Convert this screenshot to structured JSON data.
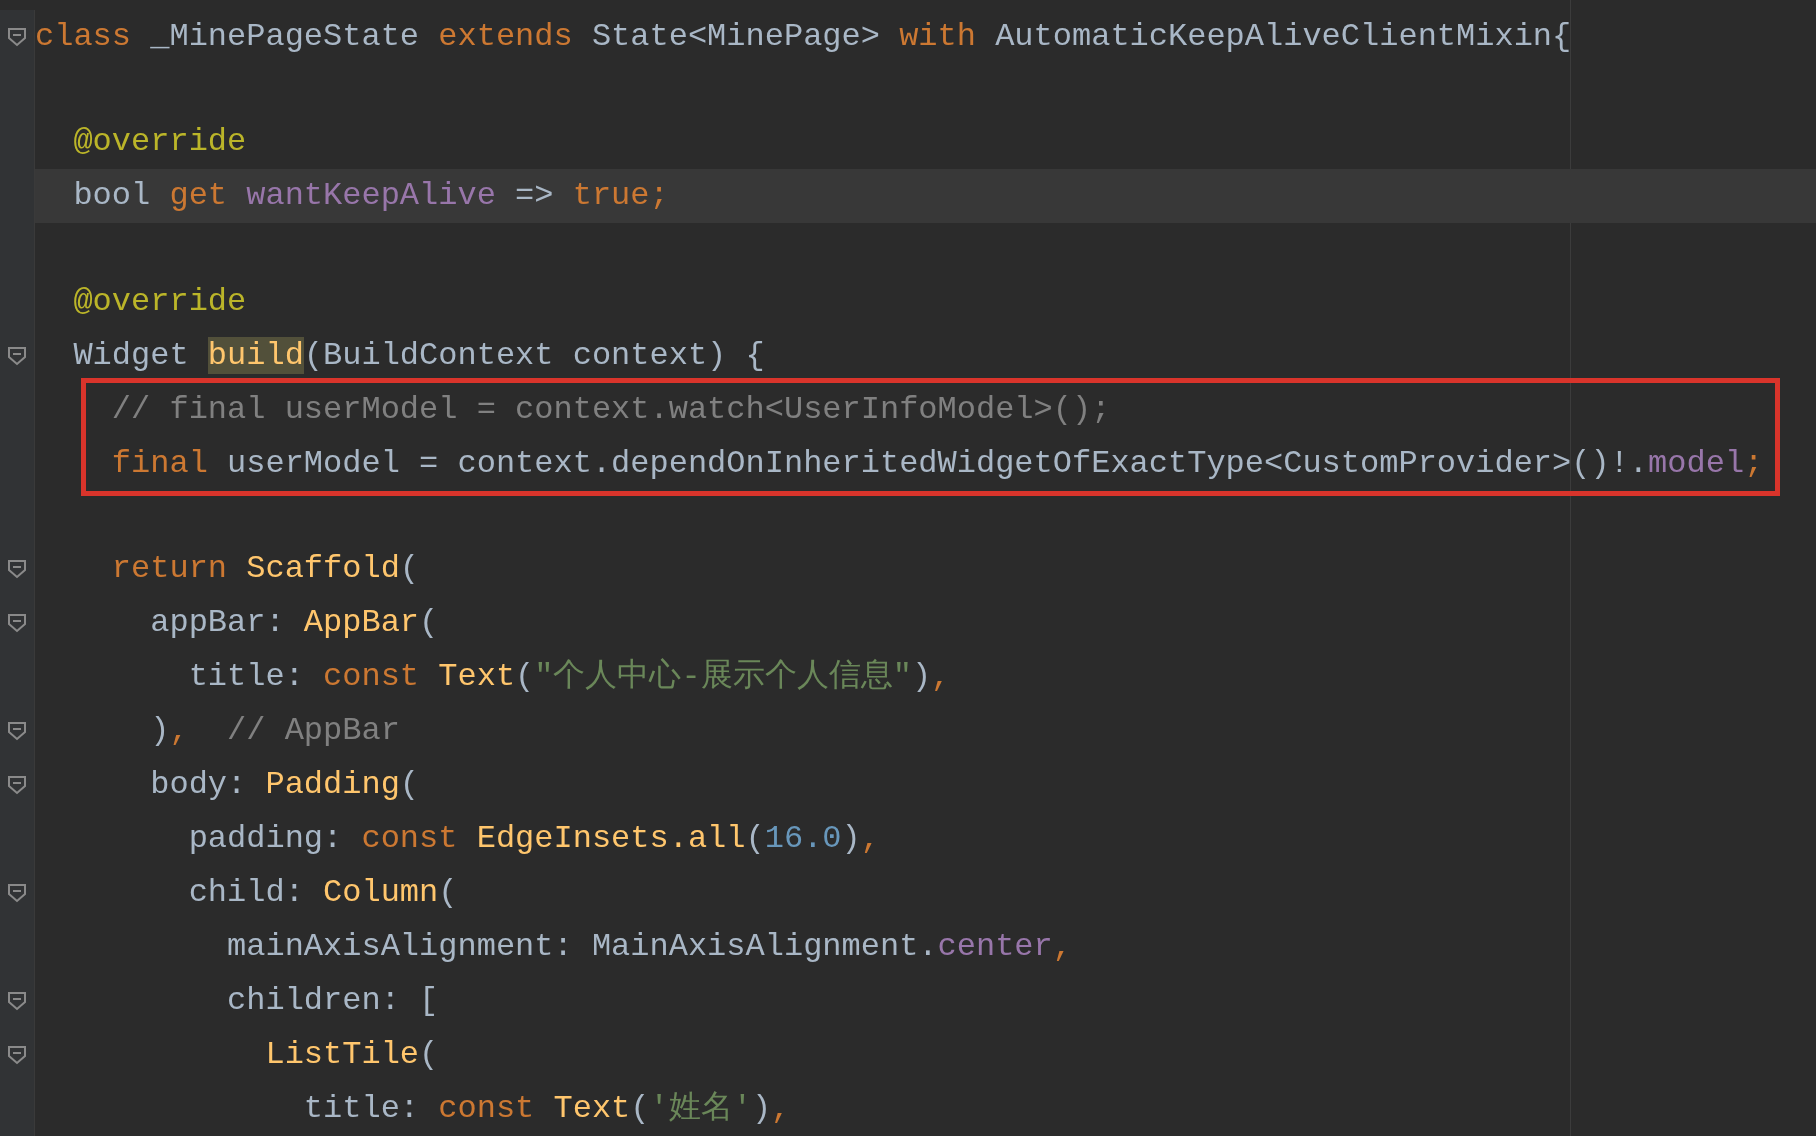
{
  "editor": {
    "lines": [
      {
        "fold": true,
        "tokens": [
          {
            "text": "class",
            "kind": "keyword"
          },
          {
            "text": " _MinePageState ",
            "kind": "plain"
          },
          {
            "text": "extends",
            "kind": "keyword"
          },
          {
            "text": " State<MinePage> ",
            "kind": "plain"
          },
          {
            "text": "with",
            "kind": "keyword"
          },
          {
            "text": " AutomaticKeepAliveClientMixin{",
            "kind": "plain"
          }
        ]
      },
      {
        "fold": false
      },
      {
        "fold": false,
        "tokens": [
          {
            "text": "  @override",
            "kind": "annotation"
          }
        ]
      },
      {
        "fold": false,
        "current": true,
        "tokens": [
          {
            "text": "  bool ",
            "kind": "plain"
          },
          {
            "text": "get ",
            "kind": "keyword"
          },
          {
            "text": "wantKeepAlive",
            "kind": "field"
          },
          {
            "text": " => ",
            "kind": "plain"
          },
          {
            "text": "true;",
            "kind": "keyword"
          }
        ]
      },
      {
        "fold": false
      },
      {
        "fold": false,
        "tokens": [
          {
            "text": "  @override",
            "kind": "annotation"
          }
        ]
      },
      {
        "fold": true,
        "tokens": [
          {
            "text": "  Widget ",
            "kind": "plain"
          },
          {
            "text": "build",
            "kind": "usage"
          },
          {
            "text": "(BuildContext context) {",
            "kind": "plain"
          }
        ]
      },
      {
        "boxed": true,
        "tokens": [
          {
            "text": "    // final userModel = context.watch<UserInfoModel>();",
            "kind": "comment"
          }
        ]
      },
      {
        "boxed": true,
        "tokens": [
          {
            "text": "    final",
            "kind": "keyword"
          },
          {
            "text": " userModel = context.dependOnInheritedWidgetOfExactType<CustomProvider>()!.",
            "kind": "plain"
          },
          {
            "text": "model",
            "kind": "field"
          },
          {
            "text": ";",
            "kind": "keyword"
          }
        ]
      },
      {
        "fold": false
      },
      {
        "fold": true,
        "tokens": [
          {
            "text": "    return ",
            "kind": "keyword"
          },
          {
            "text": "Scaffold",
            "kind": "call"
          },
          {
            "text": "(",
            "kind": "plain"
          }
        ]
      },
      {
        "fold": true,
        "tokens": [
          {
            "text": "      appBar: ",
            "kind": "plain"
          },
          {
            "text": "AppBar",
            "kind": "call"
          },
          {
            "text": "(",
            "kind": "plain"
          }
        ]
      },
      {
        "fold": false,
        "tokens": [
          {
            "text": "        title: ",
            "kind": "plain"
          },
          {
            "text": "const ",
            "kind": "keyword"
          },
          {
            "text": "Text",
            "kind": "call"
          },
          {
            "text": "(",
            "kind": "plain"
          },
          {
            "text": "\"个人中心-展示个人信息\"",
            "kind": "string"
          },
          {
            "text": ")",
            "kind": "plain"
          },
          {
            "text": ",",
            "kind": "keyword"
          }
        ]
      },
      {
        "fold": true,
        "tokens": [
          {
            "text": "      )",
            "kind": "plain"
          },
          {
            "text": ",",
            "kind": "keyword"
          },
          {
            "text": "  // AppBar",
            "kind": "comment"
          }
        ]
      },
      {
        "fold": true,
        "tokens": [
          {
            "text": "      body: ",
            "kind": "plain"
          },
          {
            "text": "Padding",
            "kind": "call"
          },
          {
            "text": "(",
            "kind": "plain"
          }
        ]
      },
      {
        "fold": false,
        "tokens": [
          {
            "text": "        padding: ",
            "kind": "plain"
          },
          {
            "text": "const ",
            "kind": "keyword"
          },
          {
            "text": "EdgeInsets.all",
            "kind": "call"
          },
          {
            "text": "(",
            "kind": "plain"
          },
          {
            "text": "16.0",
            "kind": "number"
          },
          {
            "text": ")",
            "kind": "plain"
          },
          {
            "text": ",",
            "kind": "keyword"
          }
        ]
      },
      {
        "fold": true,
        "tokens": [
          {
            "text": "        child: ",
            "kind": "plain"
          },
          {
            "text": "Column",
            "kind": "call"
          },
          {
            "text": "(",
            "kind": "plain"
          }
        ]
      },
      {
        "fold": false,
        "tokens": [
          {
            "text": "          mainAxisAlignment: MainAxisAlignment.",
            "kind": "plain"
          },
          {
            "text": "center",
            "kind": "field"
          },
          {
            "text": ",",
            "kind": "keyword"
          }
        ]
      },
      {
        "fold": true,
        "tokens": [
          {
            "text": "          children: [",
            "kind": "plain"
          }
        ]
      },
      {
        "fold": true,
        "tokens": [
          {
            "text": "            ListTile",
            "kind": "call"
          },
          {
            "text": "(",
            "kind": "plain"
          }
        ]
      },
      {
        "fold": false,
        "tokens": [
          {
            "text": "              title: ",
            "kind": "plain"
          },
          {
            "text": "const ",
            "kind": "keyword"
          },
          {
            "text": "Text",
            "kind": "call"
          },
          {
            "text": "(",
            "kind": "plain"
          },
          {
            "text": "'姓名'",
            "kind": "string"
          },
          {
            "text": ")",
            "kind": "plain"
          },
          {
            "text": ",",
            "kind": "keyword"
          }
        ]
      }
    ]
  }
}
